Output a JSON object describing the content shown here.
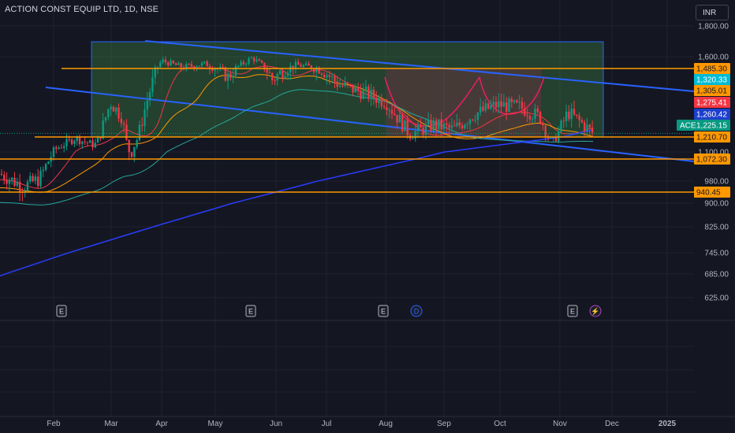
{
  "header": {
    "title": "ACTION CONST EQUIP LTD, 1D, NSE",
    "currency": "INR"
  },
  "chart_data": {
    "type": "candlestick",
    "symbol": "ACE",
    "x_ticks": [
      "Feb",
      "Mar",
      "Apr",
      "May",
      "Jun",
      "Jul",
      "Aug",
      "Sep",
      "Oct",
      "Nov",
      "Dec",
      "2025"
    ],
    "y_ticks": [
      1800,
      1600,
      1100,
      980,
      900,
      825,
      745,
      685,
      625
    ],
    "horizontal_levels": [
      {
        "label": "1,485.30",
        "value": 1485.3,
        "color": "#ff9800"
      },
      {
        "label": "1,210.70",
        "value": 1210.7,
        "color": "#ff9800"
      },
      {
        "label": "1,072.30",
        "value": 1072.3,
        "color": "#ff9800"
      },
      {
        "label": "940.45",
        "value": 940.45,
        "color": "#ff9800"
      }
    ],
    "price_labels": [
      {
        "label": "1,485.30",
        "color": "#ff9800",
        "text_color": "#131722"
      },
      {
        "label": "1,320.33",
        "color": "#00bcd4",
        "text_color": "#ffffff"
      },
      {
        "label": "1,305.01",
        "color": "#ff9800",
        "text_color": "#131722"
      },
      {
        "label": "1,275.41",
        "color": "#f23645",
        "text_color": "#ffffff"
      },
      {
        "label": "1,260.42",
        "color": "#1e3fcc",
        "text_color": "#ffffff"
      },
      {
        "label": "1,225.15",
        "color": "#089981",
        "text_color": "#ffffff"
      },
      {
        "label": "1,210.70",
        "color": "#ff9800",
        "text_color": "#131722"
      },
      {
        "label": "1,072.30",
        "color": "#ff9800",
        "text_color": "#131722"
      },
      {
        "label": "940.45",
        "color": "#ff9800",
        "text_color": "#131722"
      }
    ],
    "last_price": 1225.15,
    "channel_color": "#2962ff",
    "rectangle_color": "#4caf50",
    "cup_pattern_color": "#e91e63",
    "events": [
      {
        "label": "E",
        "month": "Feb"
      },
      {
        "label": "E",
        "month": "Jun"
      },
      {
        "label": "E",
        "month": "Aug"
      },
      {
        "label": "D",
        "month": "Aug"
      },
      {
        "label": "E",
        "month": "Nov"
      },
      {
        "label": "⚡",
        "month": "Nov"
      }
    ]
  }
}
